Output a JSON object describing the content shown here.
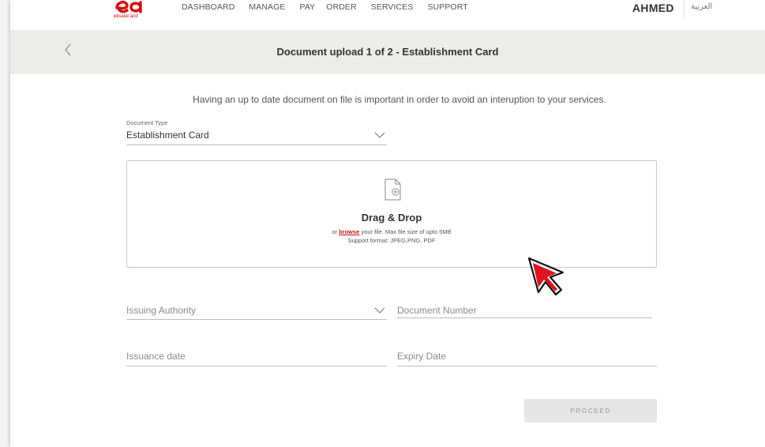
{
  "brand": {
    "logo_text": "etisalat and",
    "color": "#e00800"
  },
  "nav": {
    "items": [
      "DASHBOARD",
      "MANAGE",
      "PAY",
      "ORDER",
      "SERVICES",
      "SUPPORT"
    ],
    "user": "AHMED",
    "language": "العربية"
  },
  "header": {
    "title": "Document upload 1 of 2 - Establishment Card",
    "back_icon": "chevron-left-icon"
  },
  "intro": "Having an up to date document on file is important in order to avoid an interuption to your services.",
  "document_type": {
    "label": "Document Type",
    "value": "Establishment Card"
  },
  "dropzone": {
    "icon": "document-add-icon",
    "title": "Drag & Drop",
    "prefix": "or ",
    "browse": "browse",
    "suffix": " your file. Max file size of upto 5MB",
    "formats": "Support format: JPEG,PNG, PDF"
  },
  "fields": {
    "issuing_authority": "Issuing Authority",
    "document_number": "Document Number",
    "issuance_date": "Issuance date",
    "expiry_date": "Expiry Date"
  },
  "proceed_label": "PROCEED",
  "colors": {
    "accent": "#c1121c",
    "band": "#ecece8",
    "disabled_button": "#e6e6e6"
  }
}
